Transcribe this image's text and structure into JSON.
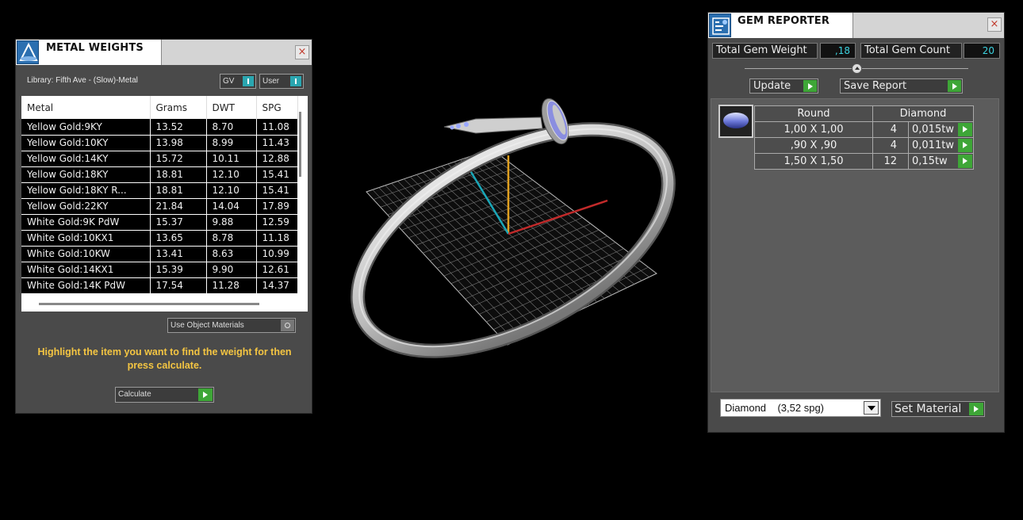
{
  "metal_weights": {
    "title": "METAL WEIGHTS",
    "close": "×",
    "library_label": "Library: Fifth Ave - (Slow)-Metal",
    "toggle_gv": "GV",
    "toggle_user": "User",
    "columns": [
      "Metal",
      "Grams",
      "DWT",
      "SPG"
    ],
    "rows": [
      [
        "Yellow Gold:9KY",
        "13.52",
        "8.70",
        "11.08"
      ],
      [
        "Yellow Gold:10KY",
        "13.98",
        "8.99",
        "11.43"
      ],
      [
        "Yellow Gold:14KY",
        "15.72",
        "10.11",
        "12.88"
      ],
      [
        "Yellow Gold:18KY",
        "18.81",
        "12.10",
        "15.41"
      ],
      [
        "Yellow Gold:18KY R...",
        "18.81",
        "12.10",
        "15.41"
      ],
      [
        "Yellow Gold:22KY",
        "21.84",
        "14.04",
        "17.89"
      ],
      [
        "White Gold:9K PdW",
        "15.37",
        "9.88",
        "12.59"
      ],
      [
        "White Gold:10KX1",
        "13.65",
        "8.78",
        "11.18"
      ],
      [
        "White Gold:10KW",
        "13.41",
        "8.63",
        "10.99"
      ],
      [
        "White Gold:14KX1",
        "15.39",
        "9.90",
        "12.61"
      ],
      [
        "White Gold:14K PdW",
        "17.54",
        "11.28",
        "14.37"
      ]
    ],
    "use_object_materials": "Use Object Materials",
    "hint": "Highlight the item you want to find the weight for then press calculate.",
    "calculate": "Calculate"
  },
  "gem_reporter": {
    "title": "GEM REPORTER",
    "close": "×",
    "total_weight_label": "Total Gem Weight",
    "total_weight_value": ",18",
    "total_count_label": "Total Gem Count",
    "total_count_value": "20",
    "update": "Update",
    "save_report": "Save Report",
    "shape": "Round",
    "material": "Diamond",
    "rows": [
      [
        "1,00 X 1,00",
        "4",
        "0,015tw"
      ],
      [
        ",90 X ,90",
        "4",
        "0,011tw"
      ],
      [
        "1,50 X 1,50",
        "12",
        "0,15tw"
      ]
    ],
    "material_select": "Diamond    (3,52 spg)",
    "set_material": "Set Material"
  },
  "colors": {
    "accent_green": "#3ea637",
    "highlight_text": "#f4c542",
    "value_cyan": "#3dd3e0"
  }
}
